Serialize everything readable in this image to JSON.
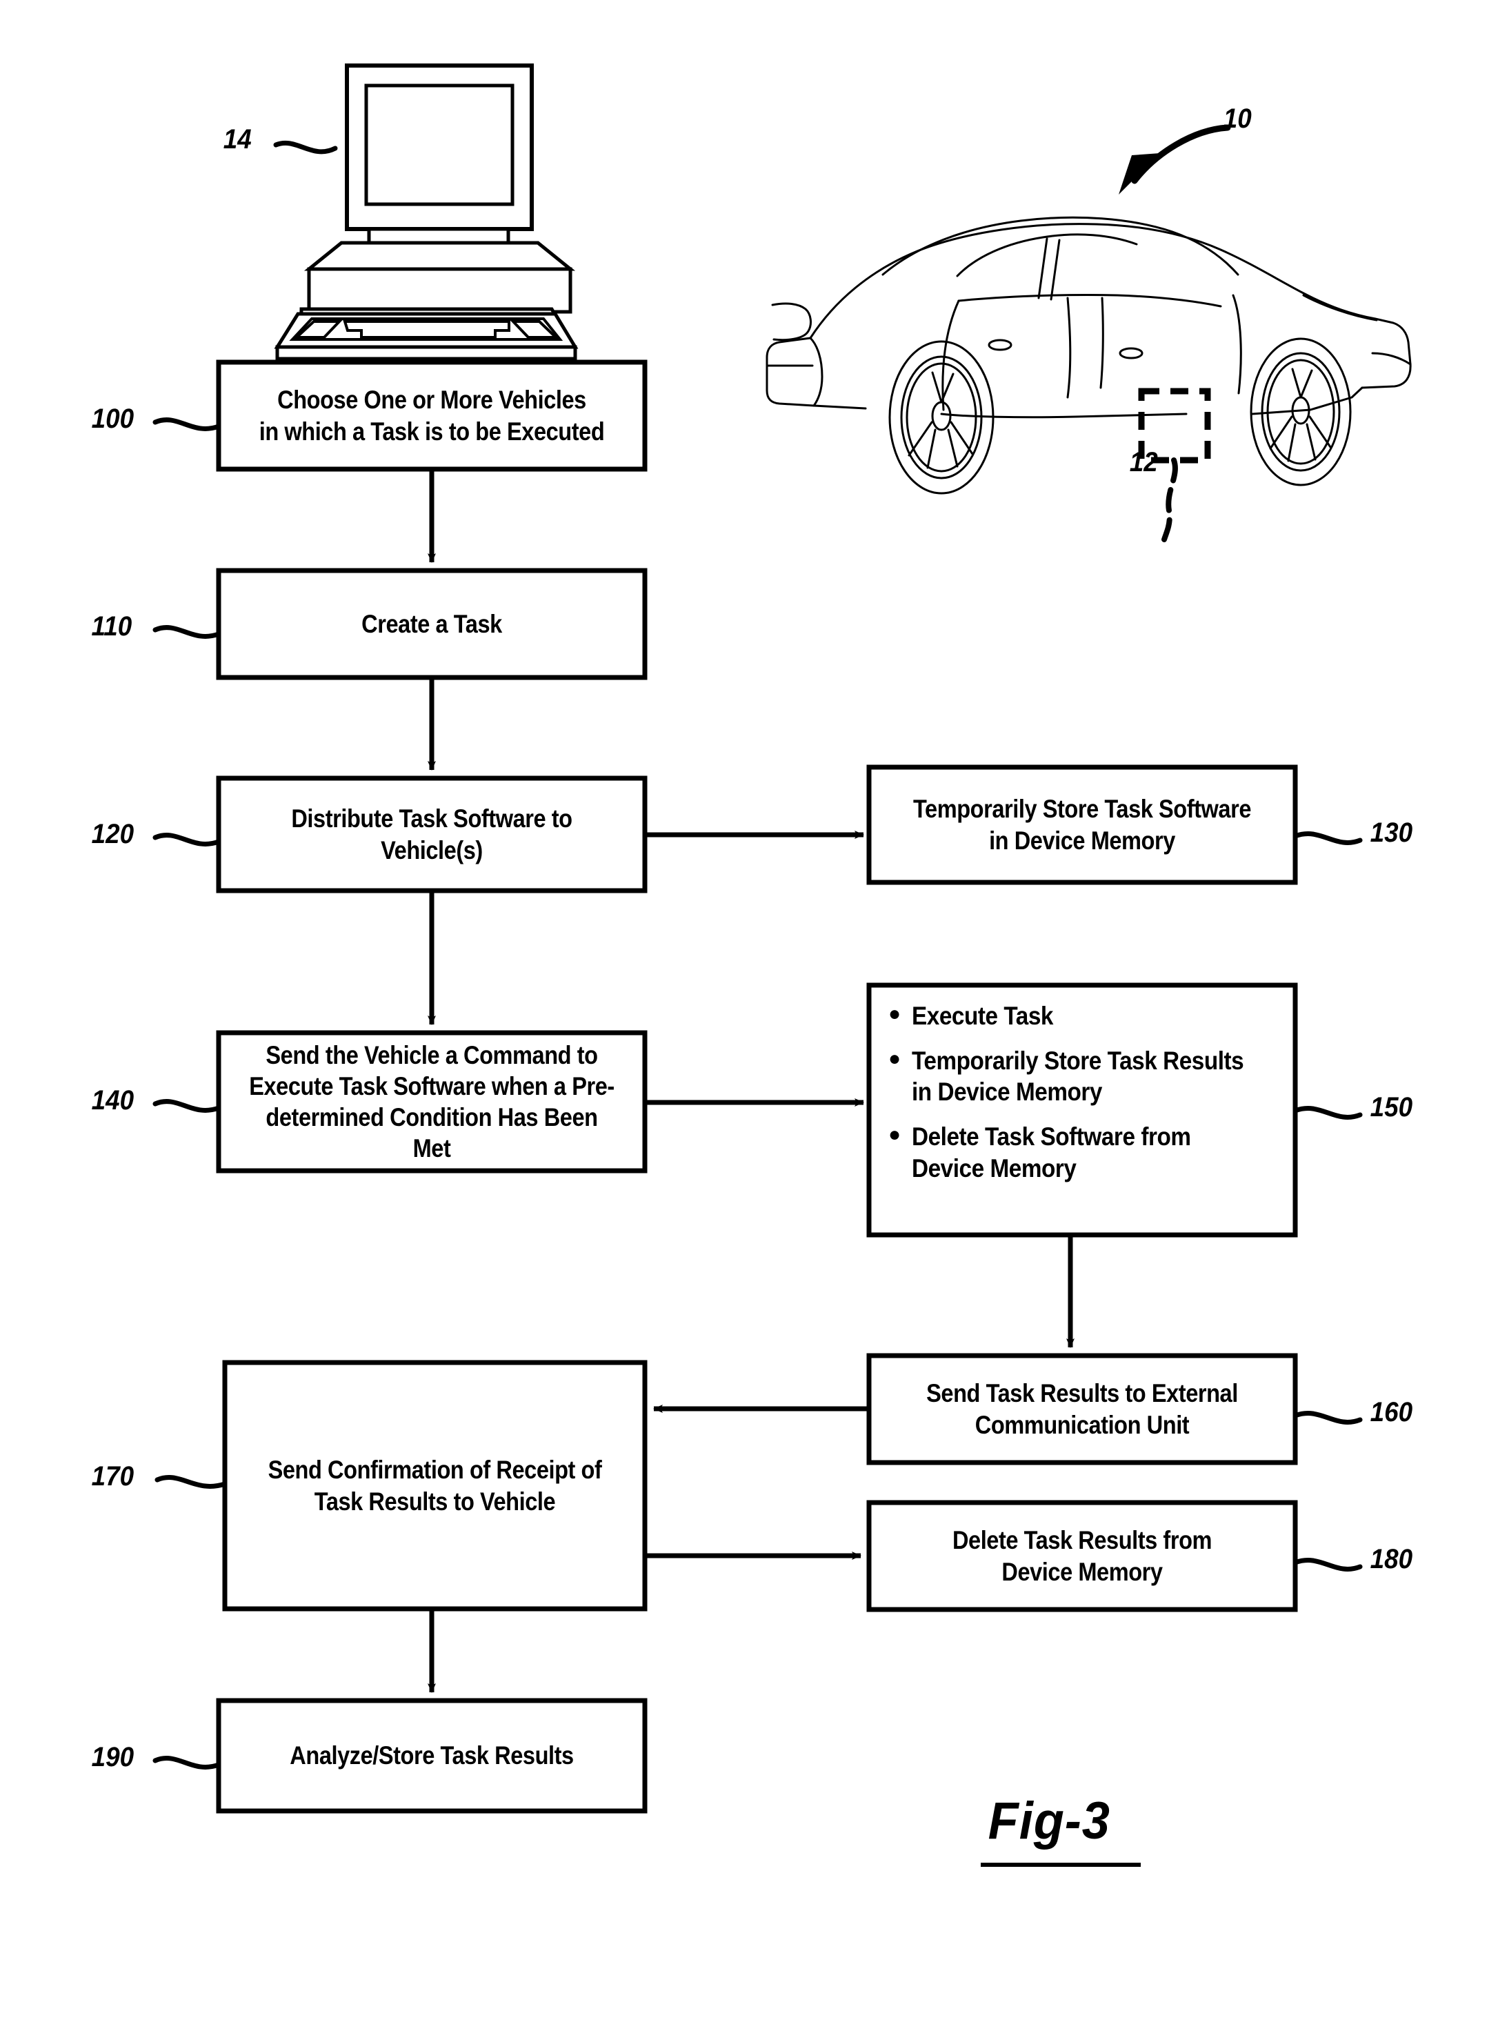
{
  "figure": {
    "caption": "Fig-3",
    "title_numeral": "10"
  },
  "reference_numerals": [
    {
      "id": "14",
      "label": "14",
      "target": "computer-workstation"
    },
    {
      "id": "10",
      "label": "10",
      "target": "system-overview"
    },
    {
      "id": "12",
      "label": "12",
      "target": "vehicle-device-module"
    },
    {
      "id": "100",
      "label": "100",
      "target": "step-100"
    },
    {
      "id": "110",
      "label": "110",
      "target": "step-110"
    },
    {
      "id": "120",
      "label": "120",
      "target": "step-120"
    },
    {
      "id": "130",
      "label": "130",
      "target": "step-130"
    },
    {
      "id": "140",
      "label": "140",
      "target": "step-140"
    },
    {
      "id": "150",
      "label": "150",
      "target": "step-150"
    },
    {
      "id": "160",
      "label": "160",
      "target": "step-160"
    },
    {
      "id": "170",
      "label": "170",
      "target": "step-170"
    },
    {
      "id": "180",
      "label": "180",
      "target": "step-180"
    },
    {
      "id": "190",
      "label": "190",
      "target": "step-190"
    }
  ],
  "illustrations": {
    "computer": {
      "name": "desktop-computer",
      "numeral": "14"
    },
    "vehicle": {
      "name": "sedan-car-side-view",
      "numeral": "10",
      "module_numeral": "12"
    }
  },
  "flowchart": {
    "steps": [
      {
        "num": "100",
        "text": "Choose One or More Vehicles\nin which a Task is to be Executed"
      },
      {
        "num": "110",
        "text": "Create a Task"
      },
      {
        "num": "120",
        "text": "Distribute Task Software to\nVehicle(s)"
      },
      {
        "num": "130",
        "text": "Temporarily Store Task Software\nin Device Memory"
      },
      {
        "num": "140",
        "text": "Send the Vehicle a Command to\nExecute Task Software when a Pre-\ndetermined Condition Has Been Met"
      },
      {
        "num": "150",
        "text": "",
        "bullets": [
          "Execute Task",
          "Temporarily Store Task Results in Device Memory",
          "Delete Task Software from Device Memory"
        ]
      },
      {
        "num": "160",
        "text": "Send Task Results to External\nCommunication Unit"
      },
      {
        "num": "170",
        "text": "Send Confirmation of Receipt of\nTask Results to Vehicle"
      },
      {
        "num": "180",
        "text": "Delete Task Results from\nDevice Memory"
      },
      {
        "num": "190",
        "text": "Analyze/Store Task Results"
      }
    ],
    "connections": [
      {
        "from": "100",
        "to": "110",
        "direction": "down"
      },
      {
        "from": "110",
        "to": "120",
        "direction": "down"
      },
      {
        "from": "120",
        "to": "130",
        "direction": "right"
      },
      {
        "from": "120",
        "to": "140",
        "direction": "down"
      },
      {
        "from": "140",
        "to": "150",
        "direction": "right"
      },
      {
        "from": "150",
        "to": "160",
        "direction": "down"
      },
      {
        "from": "160",
        "to": "170",
        "direction": "left"
      },
      {
        "from": "170",
        "to": "180",
        "direction": "right"
      },
      {
        "from": "170",
        "to": "190",
        "direction": "down"
      }
    ]
  },
  "colors": {
    "ink": "#000000",
    "paper": "#ffffff"
  }
}
